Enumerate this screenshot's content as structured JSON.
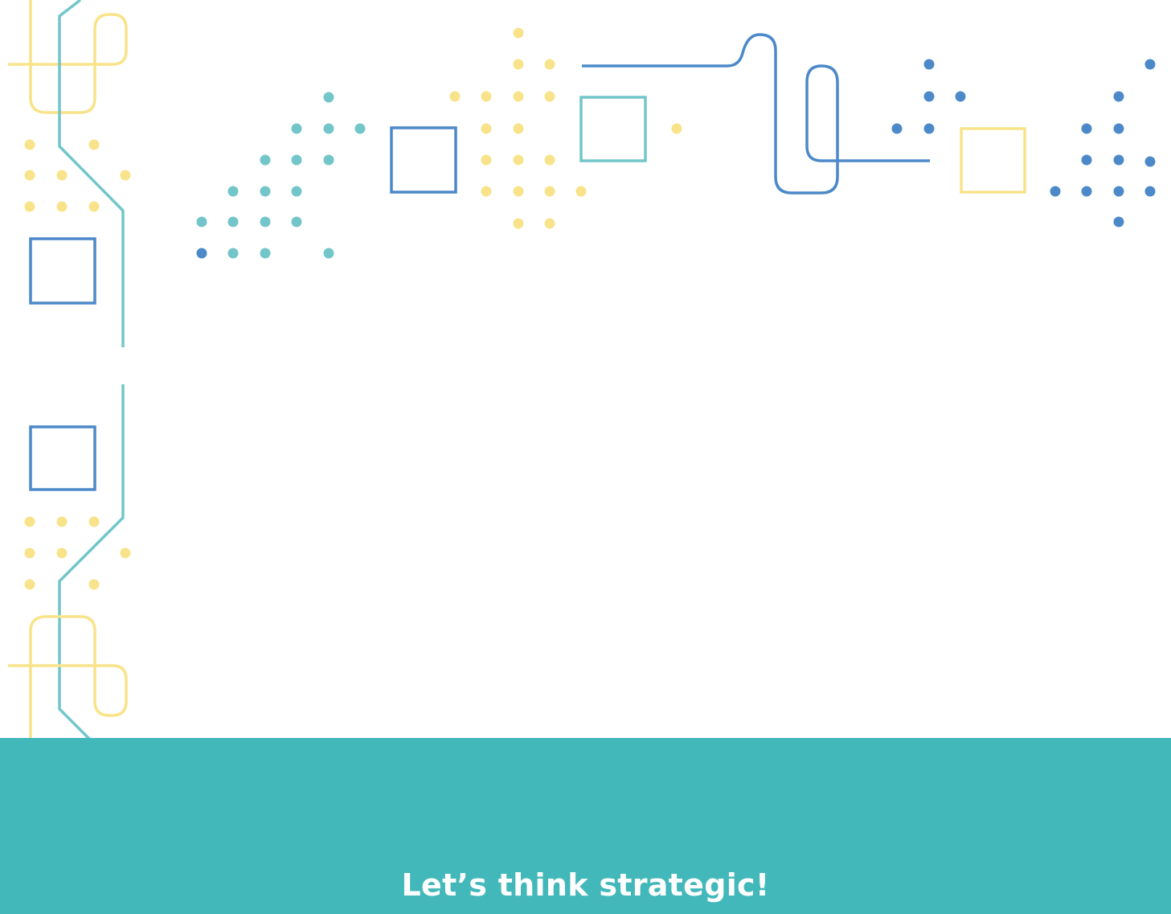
{
  "colors": {
    "yellow": "#F9E38A",
    "teal": "#72C6CA",
    "blue": "#4C89C9",
    "band": "#42B8BA",
    "band_text": "#FFFFFF"
  },
  "footer": {
    "text": "Let’s think strategic!"
  }
}
